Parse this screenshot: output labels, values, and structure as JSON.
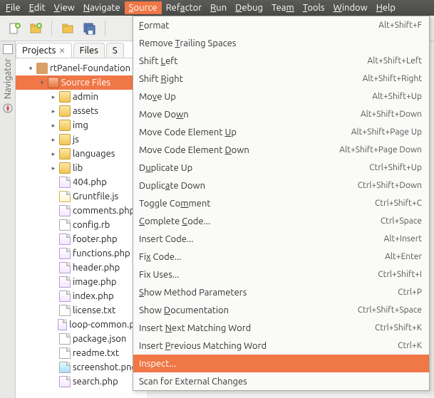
{
  "menubar": {
    "items": [
      {
        "label": "File",
        "u": 0
      },
      {
        "label": "Edit",
        "u": 0
      },
      {
        "label": "View",
        "u": 0
      },
      {
        "label": "Navigate",
        "u": 0
      },
      {
        "label": "Source",
        "u": 0,
        "open": true
      },
      {
        "label": "Refactor",
        "u": 3
      },
      {
        "label": "Run",
        "u": 0
      },
      {
        "label": "Debug",
        "u": 0
      },
      {
        "label": "Team",
        "u": 3
      },
      {
        "label": "Tools",
        "u": 0
      },
      {
        "label": "Window",
        "u": 0
      },
      {
        "label": "Help",
        "u": 0
      }
    ]
  },
  "leftgutter": {
    "label": "Navigator"
  },
  "tabs": {
    "projects": "Projects",
    "files": "Files",
    "s": "S"
  },
  "tree": {
    "root": "rtPanel-Foundation",
    "source": "Source Files",
    "folders": [
      "admin",
      "assets",
      "img",
      "js",
      "languages",
      "lib"
    ],
    "files": [
      {
        "n": "404.php",
        "k": "php"
      },
      {
        "n": "Gruntfile.js",
        "k": "js"
      },
      {
        "n": "comments.php",
        "k": "php"
      },
      {
        "n": "config.rb",
        "k": "txt"
      },
      {
        "n": "footer.php",
        "k": "php"
      },
      {
        "n": "functions.php",
        "k": "php"
      },
      {
        "n": "header.php",
        "k": "php"
      },
      {
        "n": "image.php",
        "k": "php"
      },
      {
        "n": "index.php",
        "k": "php"
      },
      {
        "n": "license.txt",
        "k": "txt"
      },
      {
        "n": "loop-common.php",
        "k": "php"
      },
      {
        "n": "package.json",
        "k": "txt"
      },
      {
        "n": "readme.txt",
        "k": "txt"
      },
      {
        "n": "screenshot.png",
        "k": "png"
      },
      {
        "n": "search.php",
        "k": "php"
      }
    ]
  },
  "dropdown": {
    "items": [
      {
        "label": "Format",
        "u": 0,
        "short": "Alt+Shift+F"
      },
      {
        "label": "Remove Trailing Spaces",
        "u": 7
      },
      {
        "label": "Shift Left",
        "u": 6,
        "short": "Alt+Shift+Left"
      },
      {
        "label": "Shift Right",
        "u": 6,
        "short": "Alt+Shift+Right"
      },
      {
        "label": "Move Up",
        "u": 2,
        "short": "Alt+Shift+Up"
      },
      {
        "label": "Move Down",
        "u": 7,
        "short": "Alt+Shift+Down"
      },
      {
        "label": "Move Code Element Up",
        "u": 18,
        "short": "Alt+Shift+Page Up"
      },
      {
        "label": "Move Code Element Down",
        "u": 18,
        "short": "Alt+Shift+Page Down"
      },
      {
        "label": "Duplicate Up",
        "u": 1,
        "short": "Ctrl+Shift+Up"
      },
      {
        "label": "Duplicate Down",
        "u": 6,
        "short": "Ctrl+Shift+Down"
      },
      {
        "label": "Toggle Comment",
        "u": 9,
        "short": "Ctrl+Shift+C"
      },
      {
        "label": "Complete Code...",
        "u2": [
          0,
          9
        ],
        "short": "Ctrl+Space"
      },
      {
        "label": "Insert Code...",
        "short": "Alt+Insert"
      },
      {
        "label": "Fix Code...",
        "u": 2,
        "short": "Alt+Enter"
      },
      {
        "label": "Fix Uses...",
        "short": "Ctrl+Shift+I"
      },
      {
        "label": "Show Method Parameters",
        "u": 0,
        "short": "Ctrl+P"
      },
      {
        "label": "Show Documentation",
        "u": 5,
        "short": "Ctrl+Shift+Space"
      },
      {
        "label": "Insert Next Matching Word",
        "u": 7,
        "short": "Ctrl+Shift+K"
      },
      {
        "label": "Insert Previous Matching Word",
        "u": 7,
        "short": "Ctrl+K"
      },
      {
        "label": "Inspect...",
        "sel": true
      },
      {
        "label": "Scan for External Changes"
      }
    ]
  }
}
